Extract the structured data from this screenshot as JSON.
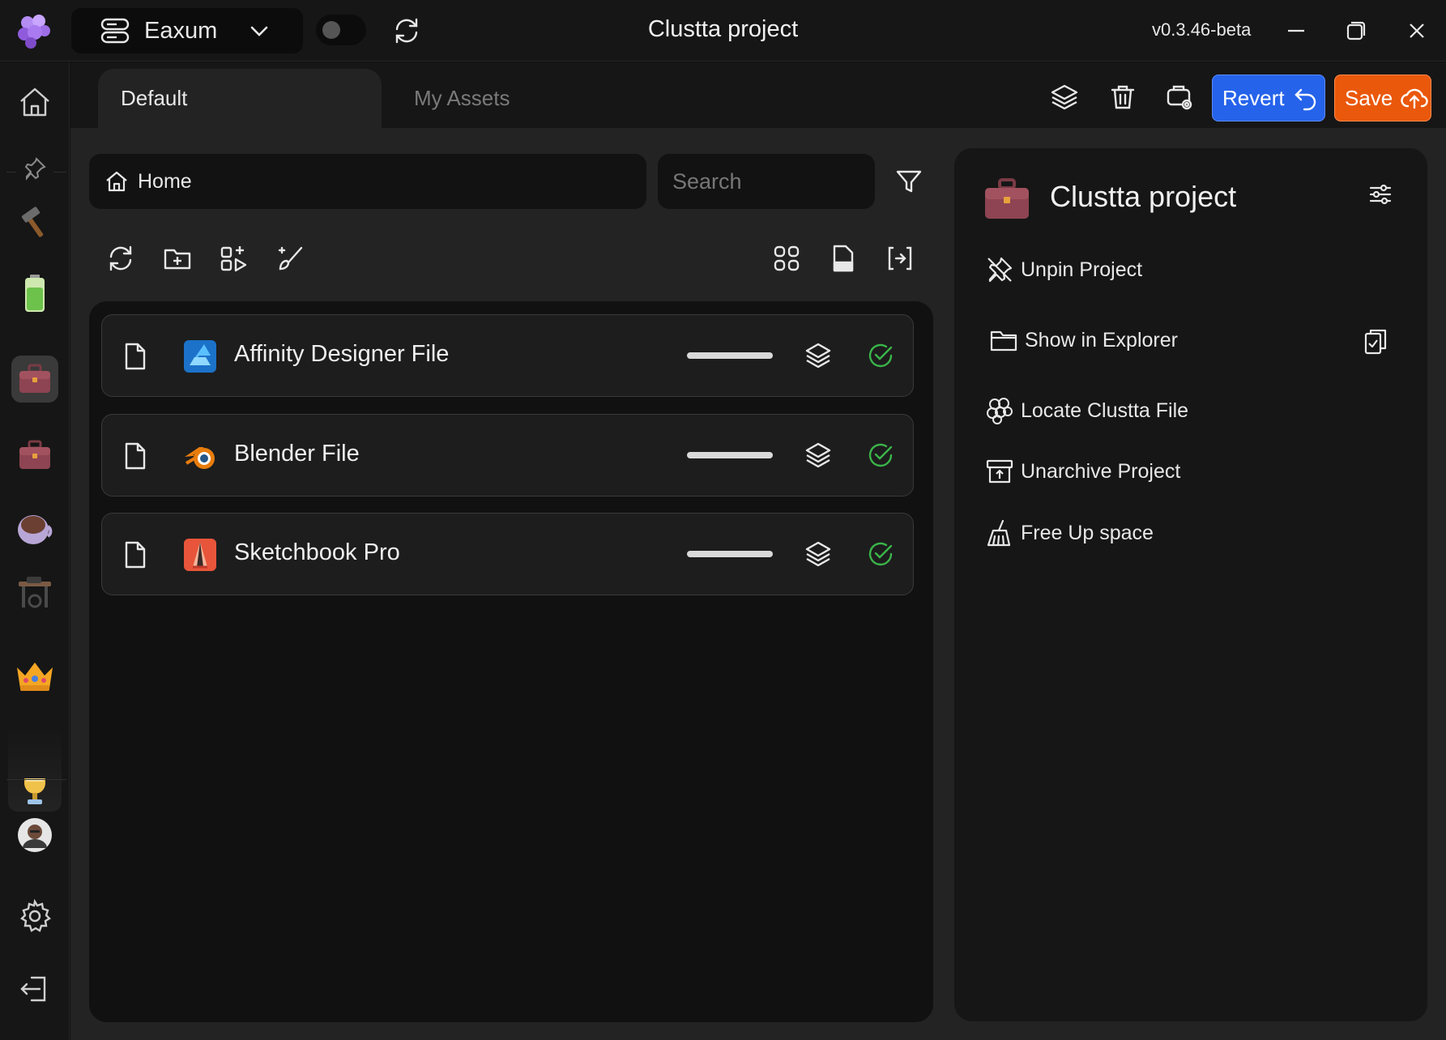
{
  "titlebar": {
    "workspace": "Eaxum",
    "title": "Clustta project",
    "version": "v0.3.46-beta"
  },
  "tabs": [
    {
      "label": "Default",
      "active": true
    },
    {
      "label": "My Assets",
      "active": false
    }
  ],
  "header_actions": {
    "revert_label": "Revert",
    "save_label": "Save",
    "colors": {
      "revert": "#2563eb",
      "save": "#ea580c"
    }
  },
  "browser": {
    "breadcrumb": "Home",
    "search_placeholder": "Search"
  },
  "files": [
    {
      "name": "Affinity Designer File",
      "icon": "affinity-designer-icon",
      "status": "synced"
    },
    {
      "name": "Blender File",
      "icon": "blender-icon",
      "status": "synced"
    },
    {
      "name": "Sketchbook Pro",
      "icon": "sketchbook-icon",
      "status": "synced"
    }
  ],
  "project_panel": {
    "name": "Clustta project",
    "actions": [
      {
        "label": "Unpin Project",
        "icon": "unpin-icon"
      },
      {
        "label": "Show in Explorer",
        "icon": "folder-icon"
      },
      {
        "label": "Locate Clustta File",
        "icon": "clustta-logo-icon"
      },
      {
        "label": "Unarchive Project",
        "icon": "archive-icon"
      },
      {
        "label": "Free Up space",
        "icon": "broom-icon"
      }
    ]
  },
  "rail": [
    {
      "name": "home",
      "icon": "home-icon"
    },
    {
      "name": "pinned",
      "icon": "pin-icon"
    },
    {
      "name": "hammer-project",
      "icon": "hammer-icon"
    },
    {
      "name": "battery-project",
      "icon": "battery-icon"
    },
    {
      "name": "briefcase-project-active",
      "icon": "briefcase-icon"
    },
    {
      "name": "briefcase-project",
      "icon": "briefcase-icon"
    },
    {
      "name": "coffee-project",
      "icon": "coffee-cup-icon"
    },
    {
      "name": "sewing-project",
      "icon": "sewing-machine-icon"
    },
    {
      "name": "crown-project",
      "icon": "crown-icon"
    },
    {
      "name": "trophy-project",
      "icon": "trophy-icon"
    },
    {
      "name": "account",
      "icon": "avatar"
    },
    {
      "name": "settings",
      "icon": "gear-icon"
    },
    {
      "name": "logout",
      "icon": "logout-icon"
    }
  ]
}
